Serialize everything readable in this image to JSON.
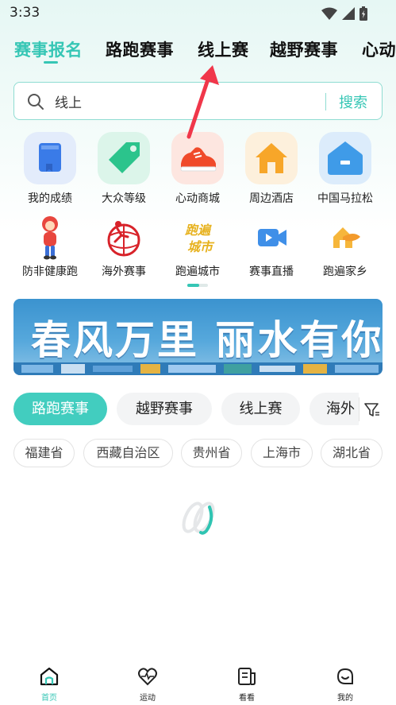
{
  "status_bar": {
    "time": "3:33"
  },
  "top_tabs": [
    {
      "label": "赛事报名",
      "active": true
    },
    {
      "label": "路跑赛事",
      "active": false
    },
    {
      "label": "线上赛",
      "active": false
    },
    {
      "label": "越野赛事",
      "active": false
    },
    {
      "label": "心动",
      "active": false
    }
  ],
  "search": {
    "value": "线上",
    "button": "搜索"
  },
  "grid": {
    "row1": [
      {
        "label": "我的成绩",
        "icon": "book-icon"
      },
      {
        "label": "大众等级",
        "icon": "tag-icon"
      },
      {
        "label": "心动商城",
        "icon": "sneaker-icon"
      },
      {
        "label": "周边酒店",
        "icon": "house-icon"
      },
      {
        "label": "中国马拉松",
        "icon": "home-badge-icon"
      }
    ],
    "row2": [
      {
        "label": "防非健康跑",
        "icon": "mascot-icon"
      },
      {
        "label": "海外赛事",
        "icon": "run-the-world-icon"
      },
      {
        "label": "跑遍城市",
        "icon": "city-logo-icon",
        "logo_text": "跑遍城市"
      },
      {
        "label": "赛事直播",
        "icon": "live-video-icon"
      },
      {
        "label": "跑遍家乡",
        "icon": "hometown-icon"
      }
    ]
  },
  "banner": {
    "text": "春风万里 丽水有你"
  },
  "filter_chips": [
    {
      "label": "路跑赛事",
      "active": true
    },
    {
      "label": "越野赛事",
      "active": false
    },
    {
      "label": "线上赛",
      "active": false
    },
    {
      "label": "海外",
      "active": false
    }
  ],
  "provinces": [
    "福建省",
    "西藏自治区",
    "贵州省",
    "上海市",
    "湖北省"
  ],
  "bottom_nav": [
    {
      "label": "首页",
      "active": true,
      "icon": "home-icon"
    },
    {
      "label": "运动",
      "active": false,
      "icon": "heart-pulse-icon"
    },
    {
      "label": "看看",
      "active": false,
      "icon": "news-icon"
    },
    {
      "label": "我的",
      "active": false,
      "icon": "smile-icon"
    }
  ],
  "colors": {
    "accent": "#36c6b5",
    "chip_active": "#42cdbf",
    "arrow": "#f0374a"
  }
}
